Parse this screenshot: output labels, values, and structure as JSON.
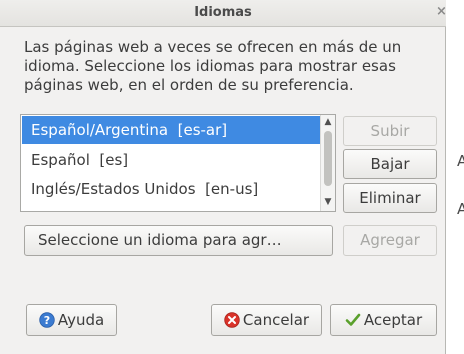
{
  "window": {
    "title": "Idiomas"
  },
  "description": "Las páginas web a veces se ofrecen en más de un idioma. Seleccione los idiomas para mostrar esas páginas web, en el orden de su preferencia.",
  "languages": [
    {
      "label": "Español/Argentina  [es-ar]",
      "selected": true
    },
    {
      "label": "Español  [es]",
      "selected": false
    },
    {
      "label": "Inglés/Estados Unidos  [en-us]",
      "selected": false
    }
  ],
  "side_buttons": {
    "subir": {
      "label": "Subir",
      "enabled": false
    },
    "bajar": {
      "label": "Bajar",
      "enabled": true
    },
    "eliminar": {
      "label": "Eliminar",
      "enabled": true
    }
  },
  "select_language": {
    "label": "Seleccione un idioma para agr…"
  },
  "agregar": {
    "label": "Agregar",
    "enabled": false
  },
  "footer": {
    "ayuda": "Ayuda",
    "cancelar": "Cancelar",
    "aceptar": "Aceptar"
  },
  "colors": {
    "selection": "#3f8ae2",
    "help_icon": "#3b7bd1",
    "cancel_icon": "#d9332a",
    "accept_icon": "#5aa02c"
  }
}
